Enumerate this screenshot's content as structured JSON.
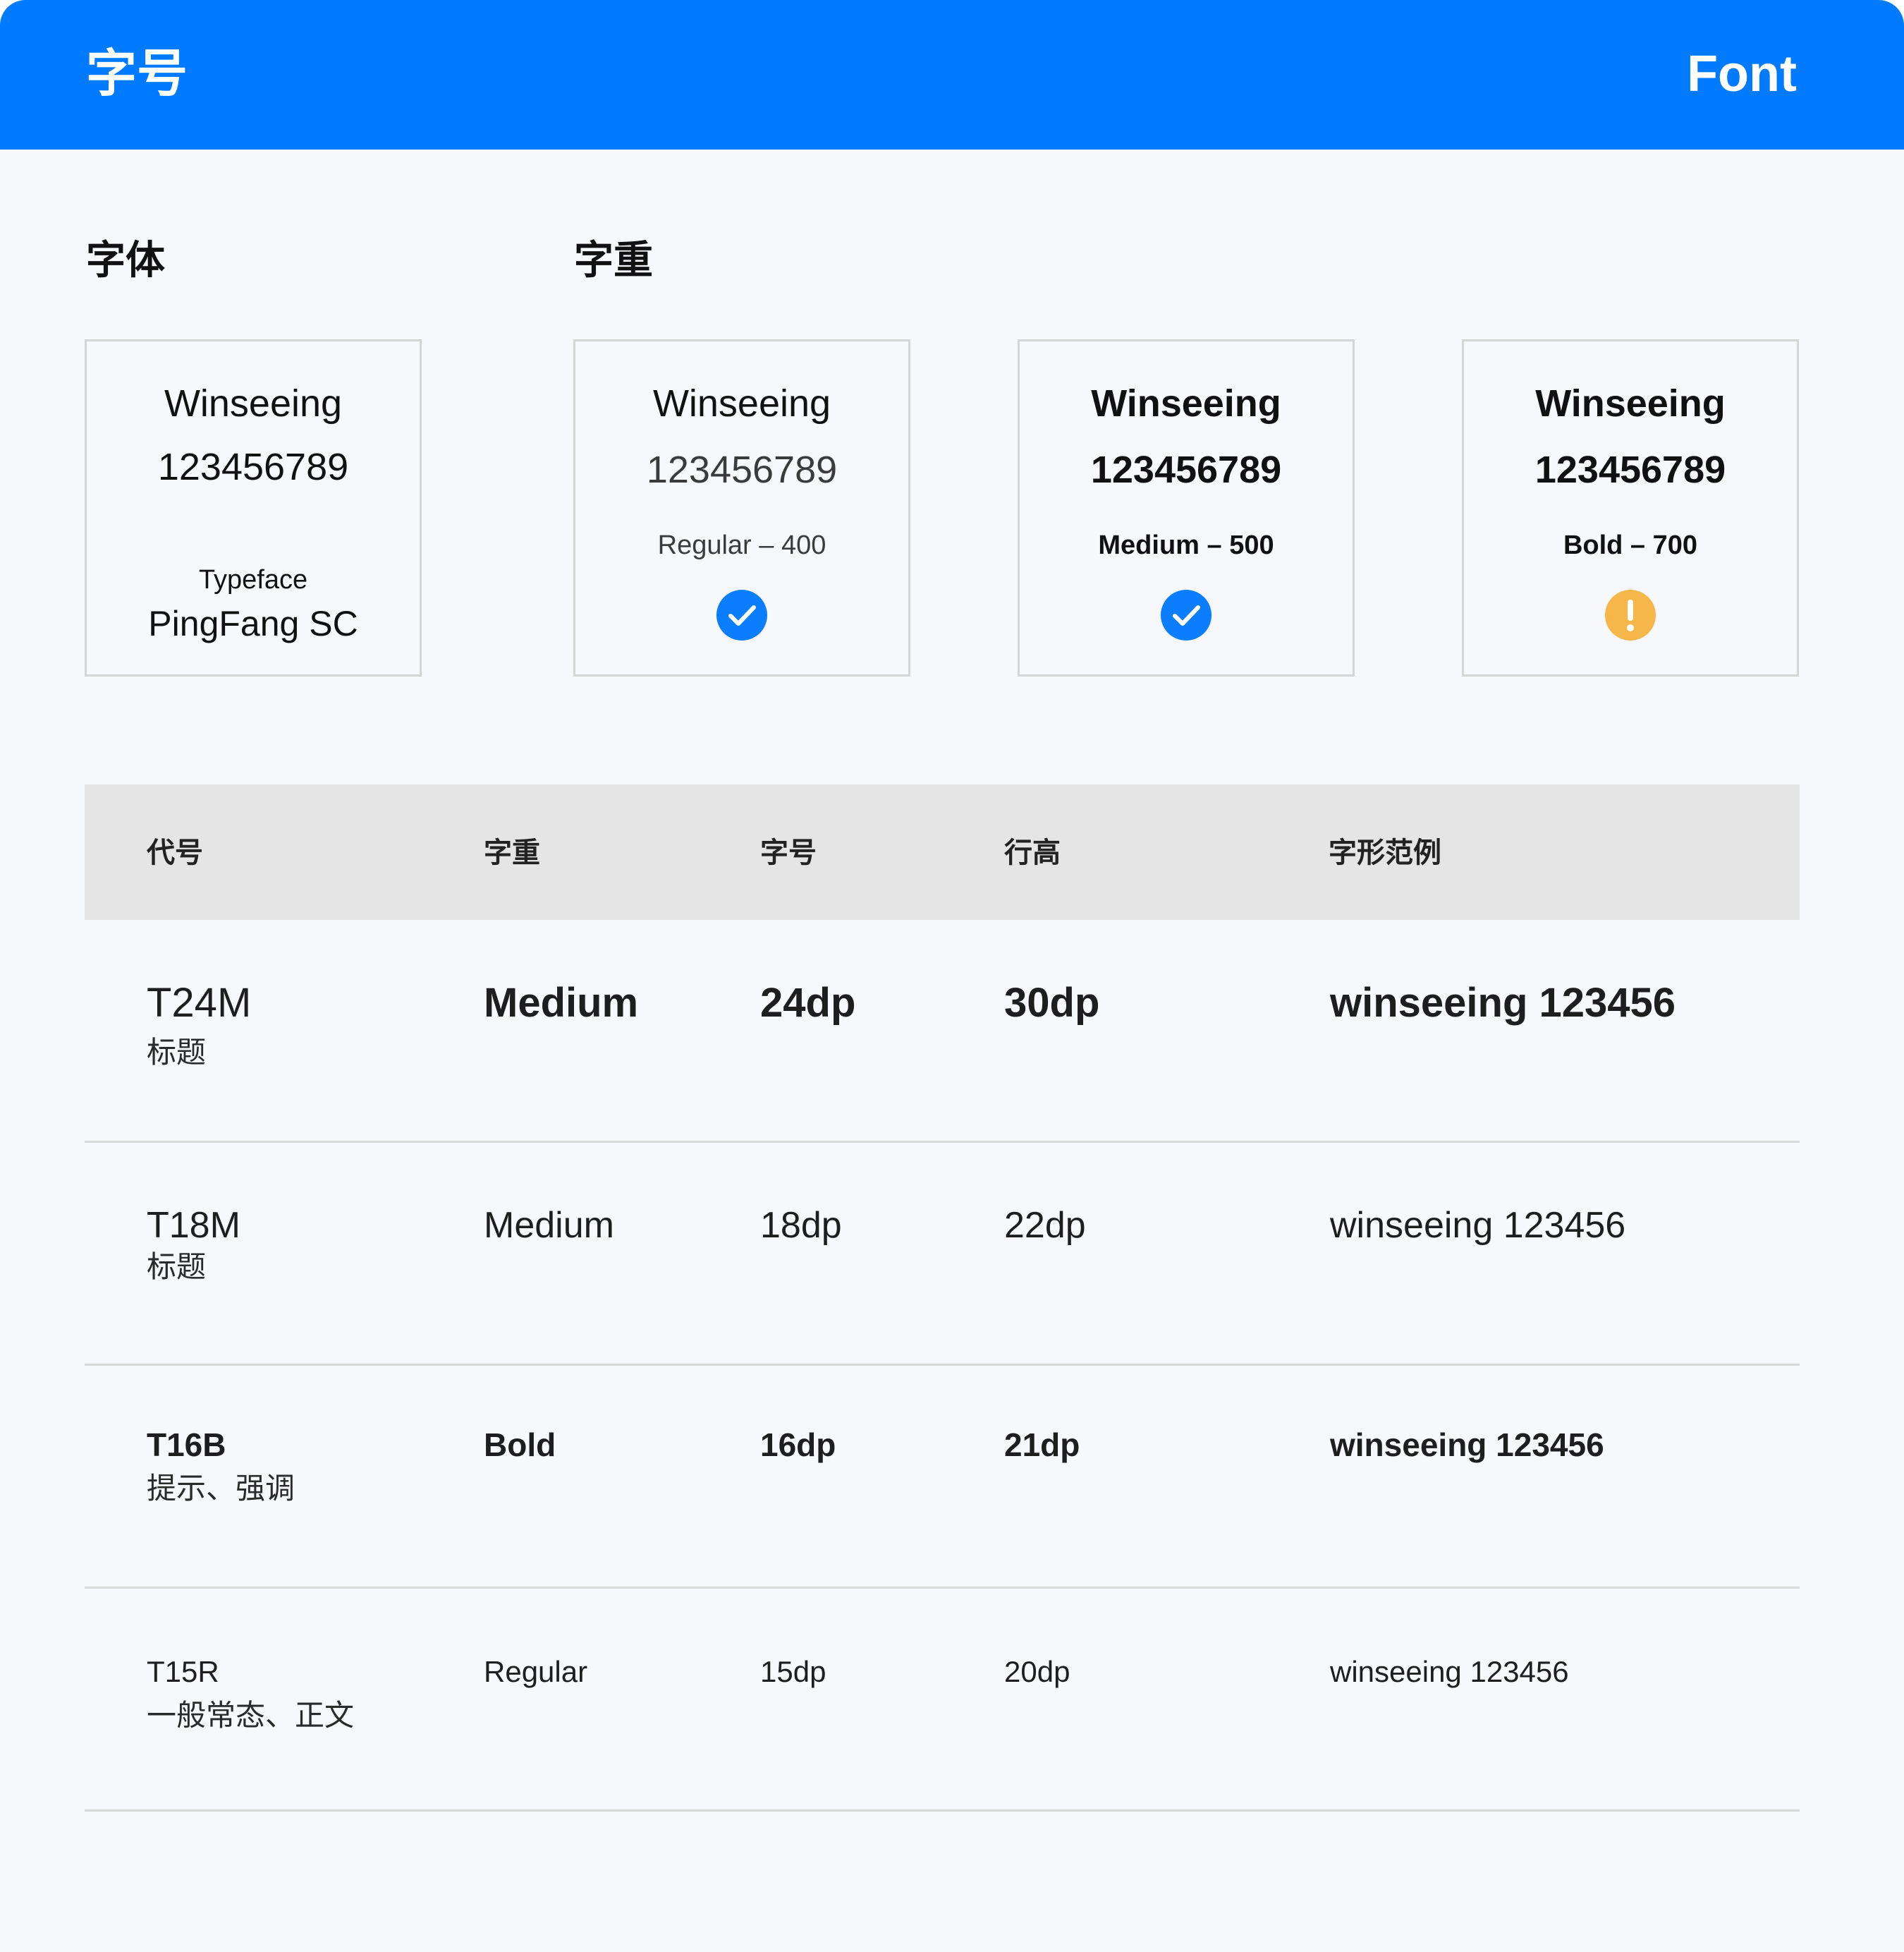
{
  "header": {
    "title": "字号",
    "right_label": "Font"
  },
  "sections": {
    "typeface_title": "字体",
    "weight_title": "字重"
  },
  "typeface_card": {
    "sample": "Winseeing",
    "digits": "123456789",
    "label": "Typeface",
    "value": "PingFang SC"
  },
  "weight_cards": [
    {
      "sample": "Winseeing",
      "digits": "123456789",
      "label": "Regular – 400",
      "status": "check",
      "status_color": "#0b7dff"
    },
    {
      "sample": "Winseeing",
      "digits": "123456789",
      "label": "Medium – 500",
      "status": "check",
      "status_color": "#0b7dff"
    },
    {
      "sample": "Winseeing",
      "digits": "123456789",
      "label": "Bold – 700",
      "status": "warning",
      "status_color": "#f5b74a"
    }
  ],
  "table": {
    "headers": [
      "代号",
      "字重",
      "字号",
      "行高",
      "字形范例"
    ],
    "rows": [
      {
        "code": "T24M",
        "usage": "标题",
        "weight": "Medium",
        "size": "24dp",
        "line_height": "30dp",
        "example": "winseeing 123456"
      },
      {
        "code": "T18M",
        "usage": "标题",
        "weight": "Medium",
        "size": "18dp",
        "line_height": "22dp",
        "example": "winseeing 123456"
      },
      {
        "code": "T16B",
        "usage": "提示、强调",
        "weight": "Bold",
        "size": "16dp",
        "line_height": "21dp",
        "example": "winseeing 123456"
      },
      {
        "code": "T15R",
        "usage": "一般常态、正文",
        "weight": "Regular",
        "size": "15dp",
        "line_height": "20dp",
        "example": "winseeing 123456"
      }
    ]
  },
  "colors": {
    "brand_blue": "#007bff",
    "background": "#f7f8fb",
    "table_header_bg": "#e5e5e5",
    "card_border": "#d5d5d5",
    "divider": "#d8d8d8",
    "warning": "#f5b74a",
    "success": "#0b7dff"
  },
  "icons": {
    "regular_status": "check-circle-icon",
    "medium_status": "check-circle-icon",
    "bold_status": "warning-circle-icon"
  }
}
